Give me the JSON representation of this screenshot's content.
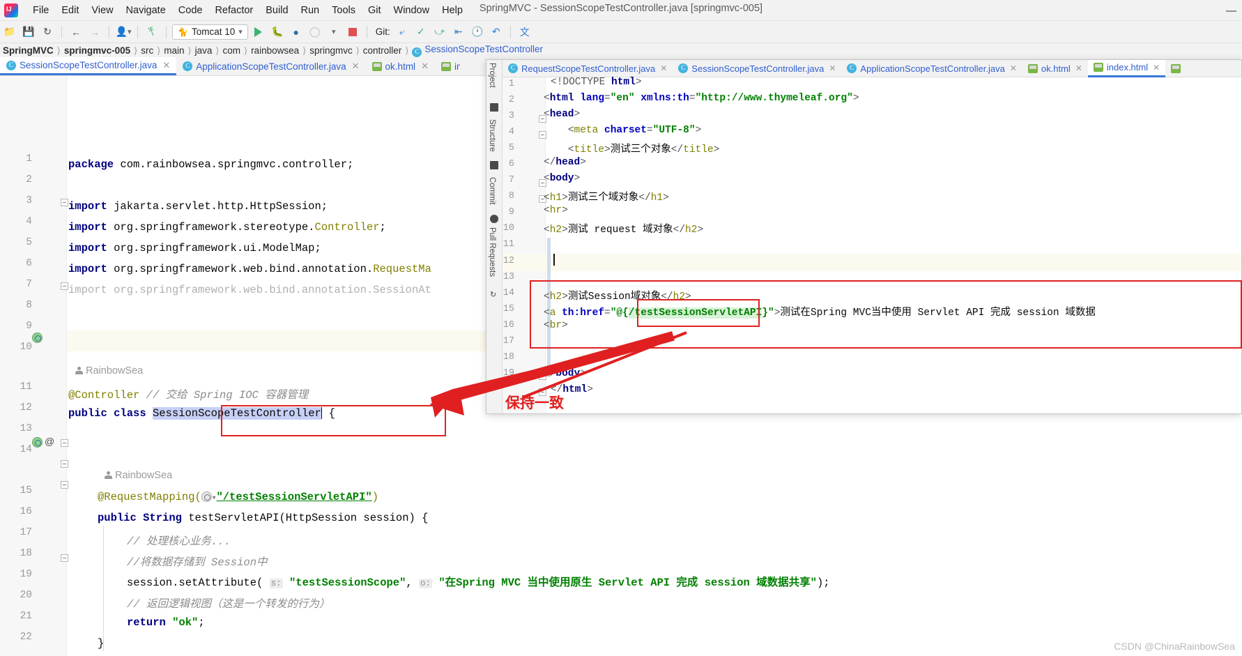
{
  "window": {
    "title": "SpringMVC - SessionScopeTestController.java [springmvc-005]",
    "minimize": "—",
    "logo_icon": "intellij-logo-icon"
  },
  "menu": {
    "items": [
      "File",
      "Edit",
      "View",
      "Navigate",
      "Code",
      "Refactor",
      "Build",
      "Run",
      "Tools",
      "Git",
      "Window",
      "Help"
    ]
  },
  "toolbar": {
    "run_config": "Tomcat 10",
    "git_label": "Git:",
    "icons": [
      "project-open-icon",
      "save-icon",
      "sync-icon",
      "back-arrow-icon",
      "forward-arrow-icon",
      "profile-icon",
      "build-hammer-icon",
      "run-icon",
      "debug-icon",
      "run-with-coverage-icon",
      "profiler-icon",
      "stop-icon",
      "update-project-icon",
      "commit-icon",
      "push-icon",
      "rollback-icon",
      "history-icon",
      "translate-icon"
    ]
  },
  "breadcrumb": {
    "items": [
      {
        "label": "SpringMVC",
        "style": "bold"
      },
      {
        "label": "springmvc-005",
        "style": "bold"
      },
      {
        "label": "src",
        "style": "plain"
      },
      {
        "label": "main",
        "style": "plain"
      },
      {
        "label": "java",
        "style": "plain"
      },
      {
        "label": "com",
        "style": "plain"
      },
      {
        "label": "rainbowsea",
        "style": "plain"
      },
      {
        "label": "springmvc",
        "style": "plain"
      },
      {
        "label": "controller",
        "style": "plain"
      },
      {
        "label": "SessionScopeTestController",
        "style": "link",
        "icon": "java-class-icon"
      }
    ]
  },
  "left_editor": {
    "tabs": [
      {
        "label": "SessionScopeTestController.java",
        "icon": "java-class-icon",
        "active": true
      },
      {
        "label": "ApplicationScopeTestController.java",
        "icon": "java-class-icon",
        "active": false
      },
      {
        "label": "ok.html",
        "icon": "html-file-icon",
        "active": false
      },
      {
        "label": "index.html",
        "icon": "html-file-icon",
        "active": false
      }
    ],
    "author_tags": [
      "RainbowSea",
      "RainbowSea"
    ],
    "lines": [
      {
        "n": 1,
        "text": "package com.rainbowsea.springmvc.controller;"
      },
      {
        "n": 2,
        "text": ""
      },
      {
        "n": 3,
        "text": "import jakarta.servlet.http.HttpSession;"
      },
      {
        "n": 4,
        "text": "import org.springframework.stereotype.Controller;"
      },
      {
        "n": 5,
        "text": "import org.springframework.ui.ModelMap;"
      },
      {
        "n": 6,
        "text": "import org.springframework.web.bind.annotation.RequestMa"
      },
      {
        "n": 7,
        "text": "import org.springframework.web.bind.annotation.SessionAt"
      },
      {
        "n": 8,
        "text": ""
      },
      {
        "n": 9,
        "text": ""
      },
      {
        "n": 10,
        "text": ""
      },
      {
        "n": 11,
        "text": "@Controller // 交给 Spring IOC 容器管理"
      },
      {
        "n": 12,
        "text": "public class SessionScopeTestController {"
      },
      {
        "n": 13,
        "text": ""
      },
      {
        "n": 14,
        "text": ""
      },
      {
        "n": 15,
        "text": "@RequestMapping(\"/testSessionServletAPI\")"
      },
      {
        "n": 16,
        "text": "public String testServletAPI(HttpSession session) {"
      },
      {
        "n": 17,
        "text": "// 处理核心业务..."
      },
      {
        "n": 18,
        "text": "//将数据存储到 Session中"
      },
      {
        "n": 19,
        "text": "session.setAttribute( s: \"testSessionScope\", o: \"在Spring MVC 当中使用原生 Servlet API 完成 session 域数据共享\");"
      },
      {
        "n": 20,
        "text": "// 返回逻辑视图（这是一个转发的行为）"
      },
      {
        "n": 21,
        "text": "return \"ok\";"
      },
      {
        "n": 22,
        "text": "}"
      }
    ],
    "param_hints": {
      "s": "s:",
      "o": "o:"
    },
    "selected_class_name": "SessionScopeTestController"
  },
  "right_editor": {
    "tabs": [
      {
        "label": "RequestScopeTestController.java",
        "icon": "java-class-icon",
        "active": false
      },
      {
        "label": "SessionScopeTestController.java",
        "icon": "java-class-icon",
        "active": false
      },
      {
        "label": "ApplicationScopeTestController.java",
        "icon": "java-class-icon",
        "active": false
      },
      {
        "label": "ok.html",
        "icon": "html-file-icon",
        "active": false
      },
      {
        "label": "index.html",
        "icon": "html-file-icon",
        "active": true
      }
    ],
    "tool_labels": [
      "Project",
      "Structure",
      "Commit",
      "Pull Requests"
    ],
    "lines": [
      {
        "n": 1,
        "text": "<!DOCTYPE html>"
      },
      {
        "n": 2,
        "text": "<html lang=\"en\" xmlns:th=\"http://www.thymeleaf.org\">"
      },
      {
        "n": 3,
        "text": "<head>"
      },
      {
        "n": 4,
        "text": "    <meta charset=\"UTF-8\">"
      },
      {
        "n": 5,
        "text": "    <title>测试三个对象</title>"
      },
      {
        "n": 6,
        "text": "</head>"
      },
      {
        "n": 7,
        "text": "<body>"
      },
      {
        "n": 8,
        "text": "<h1>测试三个域对象</h1>"
      },
      {
        "n": 9,
        "text": "<hr>"
      },
      {
        "n": 10,
        "text": "<h2>测试 request 域对象</h2>"
      },
      {
        "n": 11,
        "text": ""
      },
      {
        "n": 12,
        "text": ""
      },
      {
        "n": 13,
        "text": ""
      },
      {
        "n": 14,
        "text": "<h2>测试Session域对象</h2>"
      },
      {
        "n": 15,
        "text": "<a th:href=\"@{/testSessionServletAPI}\">测试在Spring MVC当中使用 Servlet API 完成 session 域数据"
      },
      {
        "n": 16,
        "text": "<br>"
      },
      {
        "n": 17,
        "text": ""
      },
      {
        "n": 18,
        "text": "</body>"
      },
      {
        "n": 19,
        "text": "</html>"
      }
    ],
    "highlighted_token": "/testSessionServletAPI",
    "caret_line": 12
  },
  "annotations": {
    "note_text": "保持一致",
    "accent_color": "#e02020",
    "boxes": [
      "java-request-mapping-box",
      "html-thymeleaf-link-box",
      "html-session-block-box"
    ],
    "arrows": [
      "arrow-to-java-mapping",
      "arrow-to-html-link"
    ]
  },
  "watermark": {
    "text": "CSDN @ChinaRainbowSea"
  }
}
